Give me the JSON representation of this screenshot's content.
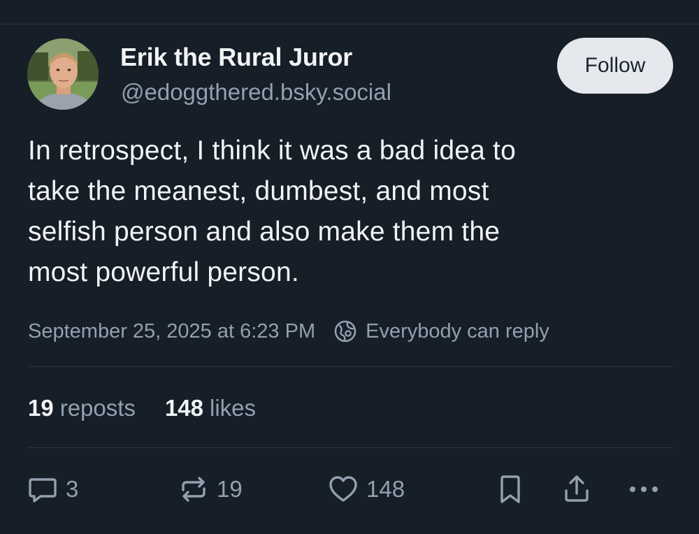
{
  "author": {
    "display_name": "Erik the Rural Juror",
    "handle": "@edoggthered.bsky.social"
  },
  "follow_button": {
    "label": "Follow"
  },
  "post": {
    "text": "In retrospect, I think it was a bad idea to\ntake the meanest, dumbest, and most\nselfish person and also make them the\nmost powerful person.",
    "timestamp": "September 25, 2025 at 6:23 PM",
    "reply_setting": "Everybody can reply"
  },
  "stats": {
    "reposts_count": "19",
    "reposts_label": "reposts",
    "likes_count": "148",
    "likes_label": "likes"
  },
  "actions": {
    "reply_count": "3",
    "repost_count": "19",
    "like_count": "148",
    "icons": [
      "reply-icon",
      "repost-icon",
      "heart-icon",
      "bookmark-icon",
      "share-icon",
      "more-icon"
    ]
  },
  "colors": {
    "background": "#161e27",
    "text_primary": "#f1f3f5",
    "text_secondary": "#93a0b0",
    "divider": "#2a3441",
    "follow_bg": "#e5e8ec"
  }
}
